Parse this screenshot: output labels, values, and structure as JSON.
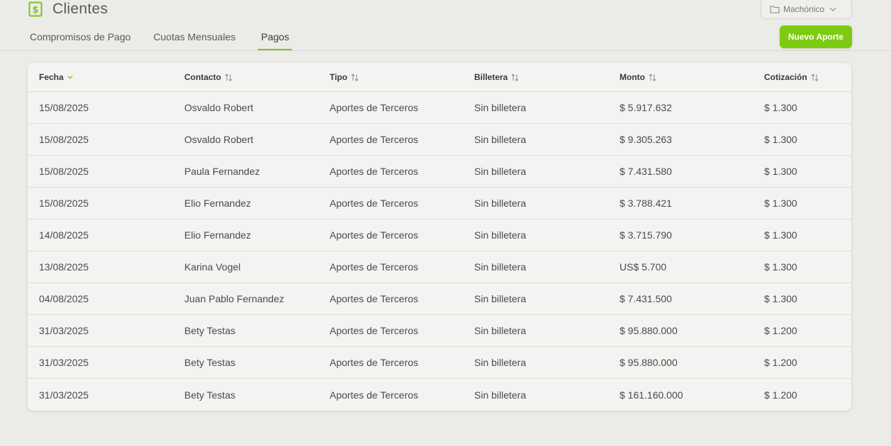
{
  "app": {
    "title": "Clientes",
    "accent": "#7dcb10"
  },
  "workspace": {
    "label": "Machónico"
  },
  "tabs": [
    {
      "label": "Compromisos de Pago"
    },
    {
      "label": "Cuotas Mensuales"
    },
    {
      "label": "Pagos"
    }
  ],
  "new_button": {
    "label": "Nuevo Aporte"
  },
  "table": {
    "headers": [
      "Fecha",
      "Contacto",
      "Tipo",
      "Billetera",
      "Monto",
      "Cotización"
    ],
    "rows": [
      [
        "15/08/2025",
        "Osvaldo Robert",
        "Aportes de Terceros",
        "Sin billetera",
        "$ 5.917.632",
        "$ 1.300"
      ],
      [
        "15/08/2025",
        "Osvaldo Robert",
        "Aportes de Terceros",
        "Sin billetera",
        "$ 9.305.263",
        "$ 1.300"
      ],
      [
        "15/08/2025",
        "Paula Fernandez",
        "Aportes de Terceros",
        "Sin billetera",
        "$ 7.431.580",
        "$ 1.300"
      ],
      [
        "15/08/2025",
        "Elio Fernandez",
        "Aportes de Terceros",
        "Sin billetera",
        "$ 3.788.421",
        "$ 1.300"
      ],
      [
        "14/08/2025",
        "Elio Fernandez",
        "Aportes de Terceros",
        "Sin billetera",
        "$ 3.715.790",
        "$ 1.300"
      ],
      [
        "13/08/2025",
        "Karina Vogel",
        "Aportes de Terceros",
        "Sin billetera",
        "US$ 5.700",
        "$ 1.300"
      ],
      [
        "04/08/2025",
        "Juan Pablo Fernandez",
        "Aportes de Terceros",
        "Sin billetera",
        "$ 7.431.500",
        "$ 1.300"
      ],
      [
        "31/03/2025",
        "Bety Testas",
        "Aportes de Terceros",
        "Sin billetera",
        "$ 95.880.000",
        "$ 1.200"
      ],
      [
        "31/03/2025",
        "Bety Testas",
        "Aportes de Terceros",
        "Sin billetera",
        "$ 95.880.000",
        "$ 1.200"
      ],
      [
        "31/03/2025",
        "Bety Testas",
        "Aportes de Terceros",
        "Sin billetera",
        "$ 161.160.000",
        "$ 1.200"
      ]
    ]
  }
}
